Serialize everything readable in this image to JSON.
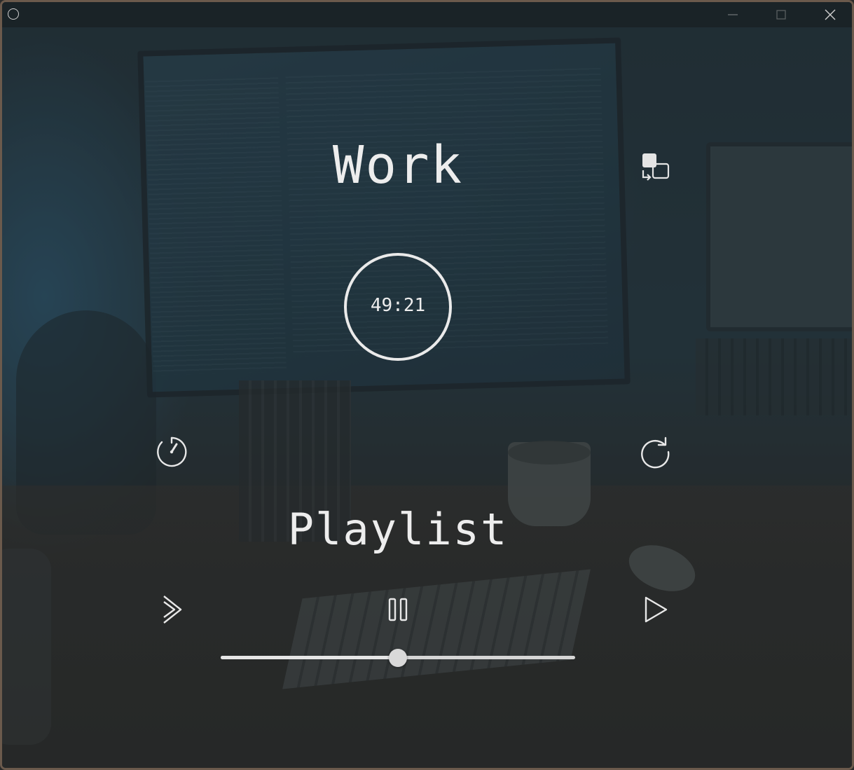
{
  "window": {
    "app_icon": "circle-app-icon",
    "controls": {
      "minimize_icon": "minimize-icon",
      "maximize_icon": "maximize-icon",
      "close_icon": "close-icon"
    }
  },
  "session": {
    "title": "Work",
    "swap_icon": "swap-windows-icon",
    "timer": "49:21"
  },
  "actions": {
    "stopwatch_icon": "stopwatch-icon",
    "reset_icon": "refresh-icon"
  },
  "player": {
    "label": "Playlist",
    "skip_icon": "double-chevron-right-icon",
    "pause_icon": "pause-icon",
    "play_icon": "play-icon",
    "volume_fraction": 0.5
  },
  "colors": {
    "foreground": "#ededed",
    "overlay": "#1e282c"
  }
}
